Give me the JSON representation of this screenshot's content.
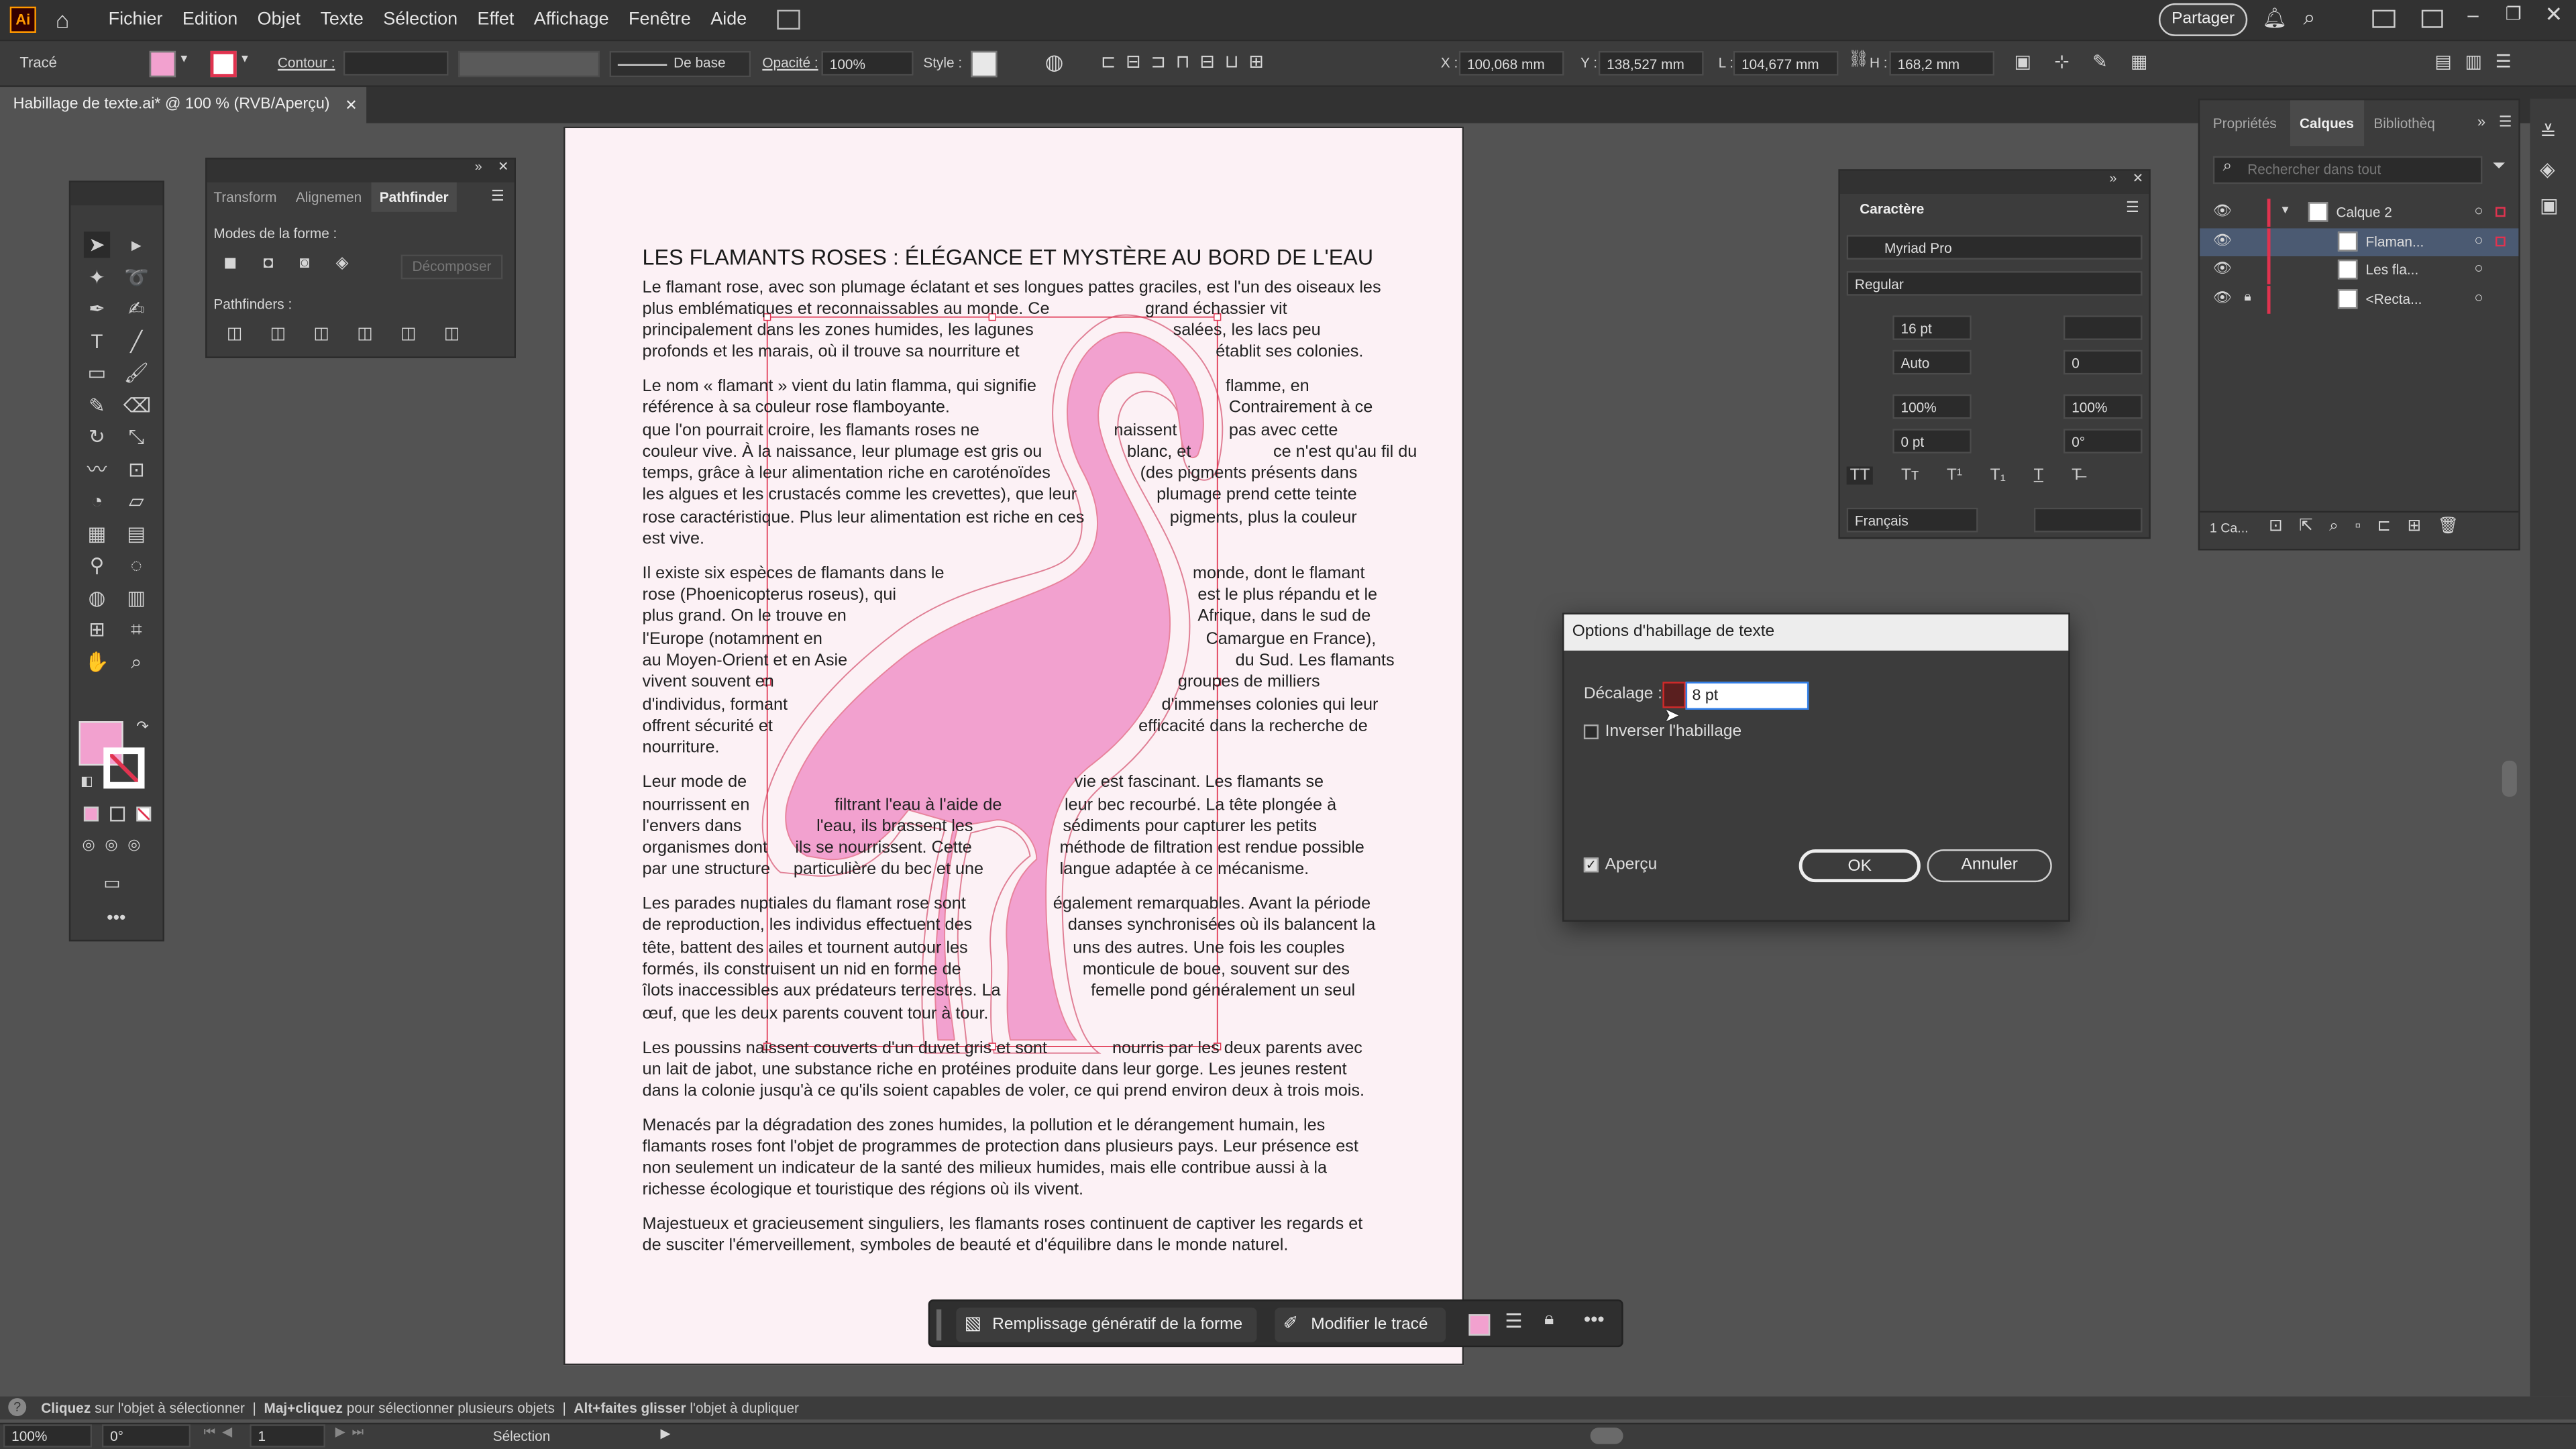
{
  "app": {
    "logo": "Ai",
    "share": "Partager"
  },
  "menu": [
    "Fichier",
    "Edition",
    "Objet",
    "Texte",
    "Sélection",
    "Effet",
    "Affichage",
    "Fenêtre",
    "Aide"
  ],
  "control_bar": {
    "object_type": "Tracé",
    "stroke_label": "Contour :",
    "stroke_style": "De base",
    "opacity_label": "Opacité :",
    "opacity_value": "100%",
    "style_label": "Style :",
    "x_label": "X :",
    "x_value": "100,068 mm",
    "y_label": "Y :",
    "y_value": "138,527 mm",
    "w_label": "L :",
    "w_value": "104,677 mm",
    "h_label": "H :",
    "h_value": "168,2 mm",
    "fill_color": "#f2a1cf"
  },
  "document_tab": {
    "title": "Habillage de texte.ai* @ 100 % (RVB/Aperçu)"
  },
  "pathfinder_panel": {
    "tabs": [
      "Transform",
      "Alignemen",
      "Pathfinder"
    ],
    "shape_modes_label": "Modes de la forme :",
    "expand_label": "Décomposer",
    "pathfinders_label": "Pathfinders :"
  },
  "character_panel": {
    "title": "Caractère",
    "font": "Myriad Pro",
    "style": "Regular",
    "size": "16 pt",
    "leading": "",
    "kerning": "Auto",
    "tracking": "0",
    "vscale": "100%",
    "hscale": "100%",
    "baseline": "0 pt",
    "rotation": "0°",
    "language": "Français"
  },
  "right_panel": {
    "tabs": [
      "Propriétés",
      "Calques",
      "Bibliothèq"
    ],
    "search_placeholder": "Rechercher dans tout",
    "layers": [
      {
        "name": "Calque 2"
      },
      {
        "name": "Flaman..."
      },
      {
        "name": "Les fla..."
      },
      {
        "name": "<Recta..."
      }
    ],
    "footer_label": "1 Ca..."
  },
  "dialog": {
    "title": "Options d'habillage de texte",
    "offset_label": "Décalage :",
    "offset_value": "8 pt",
    "invert_label": "Inverser l'habillage",
    "preview_label": "Aperçu",
    "ok_label": "OK",
    "cancel_label": "Annuler"
  },
  "context_bar": {
    "gen_fill": "Remplissage génératif de la forme",
    "edit_path": "Modifier le tracé"
  },
  "status_bar": {
    "hint_a_bold": "Cliquez",
    "hint_a": "sur l'objet à sélectionner",
    "hint_b_bold": "Maj+cliquez",
    "hint_b": "pour sélectionner plusieurs objets",
    "hint_c_bold": "Alt+faites glisser",
    "hint_c": "l'objet à dupliquer"
  },
  "bottom_bar": {
    "zoom": "100%",
    "rotation": "0°",
    "artboard": "1",
    "tool": "Sélection"
  },
  "document": {
    "title": "LES FLAMANTS ROSES : ÉLÉGANCE ET MYSTÈRE AU BORD DE L'EAU",
    "lines": [
      [
        "Le flamant rose, avec son plumage éclatant et ses longues pattes graciles, est l'un des oiseaux les"
      ],
      [
        "plus emblématiques et reconnaissables au monde. Ce",
        "grand échassier vit"
      ],
      [
        "principalement dans les zones humides, les lagunes",
        "salées, les lacs peu"
      ],
      [
        "profonds et les marais, où il trouve sa nourriture et",
        "établit ses colonies."
      ],
      [
        "Le nom « flamant » vient du latin flamma, qui signifie",
        "flamme, en"
      ],
      [
        "référence à sa couleur rose flamboyante.",
        "Contrairement à ce"
      ],
      [
        "que l'on pourrait croire, les flamants roses ne",
        "naissent",
        "pas avec cette"
      ],
      [
        "couleur vive. À la naissance, leur plumage est gris ou",
        "blanc, et",
        "ce n'est qu'au fil du"
      ],
      [
        "temps, grâce à leur alimentation riche en caroténoïdes",
        "(des pigments présents dans"
      ],
      [
        "les algues et les crustacés comme les crevettes), que leur",
        "plumage prend cette teinte"
      ],
      [
        "rose caractéristique. Plus leur alimentation est riche en ces",
        "pigments, plus la couleur"
      ],
      [
        "est vive."
      ],
      [
        "Il existe six espèces de flamants dans le",
        "monde, dont le flamant"
      ],
      [
        "rose (Phoenicopterus roseus), qui",
        "est le plus répandu et le"
      ],
      [
        "plus grand. On le trouve en",
        "Afrique, dans le sud de"
      ],
      [
        "l'Europe (notamment en",
        "Camargue en France),"
      ],
      [
        "au Moyen-Orient et en Asie",
        "du Sud. Les flamants"
      ],
      [
        "vivent souvent en",
        "groupes de milliers"
      ],
      [
        "d'individus, formant",
        "d'immenses colonies qui leur"
      ],
      [
        "offrent sécurité et",
        "efficacité dans la recherche de"
      ],
      [
        "nourriture."
      ],
      [
        "Leur mode de",
        "vie est fascinant. Les flamants se"
      ],
      [
        "nourrissent en",
        "filtrant l'eau à l'aide de",
        "leur bec recourbé. La tête plongée à"
      ],
      [
        "l'envers dans",
        "l'eau, ils brassent les",
        "sédiments pour capturer les petits"
      ],
      [
        "organismes dont",
        "ils se nourrissent. Cette",
        "méthode de filtration est rendue possible"
      ],
      [
        "par une structure",
        "particulière du bec et une",
        "langue adaptée à ce mécanisme."
      ],
      [
        "Les parades nuptiales du flamant rose sont",
        "également remarquables. Avant la période"
      ],
      [
        "de reproduction, les individus effectuent des",
        "danses synchronisées où ils balancent la"
      ],
      [
        "tête, battent des ailes et tournent autour les",
        "uns des autres. Une fois les couples"
      ],
      [
        "formés, ils construisent un nid en forme de",
        "monticule de boue, souvent sur des"
      ],
      [
        "îlots inaccessibles aux prédateurs terrestres. La",
        "femelle pond généralement un seul"
      ],
      [
        "œuf, que les deux parents couvent tour à tour."
      ],
      [
        "Les poussins naissent couverts d'un duvet gris et sont",
        "nourris par les deux parents avec"
      ],
      [
        "un lait de jabot, une substance riche en protéines produite dans leur gorge. Les jeunes restent"
      ],
      [
        "dans la colonie jusqu'à ce qu'ils soient capables de voler, ce qui prend environ deux à trois mois."
      ],
      [
        "Menacés par la dégradation des zones humides, la pollution et le dérangement humain, les"
      ],
      [
        "flamants roses font l'objet de programmes de protection dans plusieurs pays. Leur présence est"
      ],
      [
        "non seulement un indicateur de la santé des milieux humides, mais elle contribue aussi à la"
      ],
      [
        "richesse écologique et touristique des régions où ils vivent."
      ],
      [
        "Majestueux et gracieusement singuliers, les flamants roses continuent de captiver les regards et"
      ],
      [
        "de susciter l'émerveillement, symboles de beauté et d'équilibre dans le monde naturel."
      ]
    ]
  },
  "colors": {
    "flamingo": "#f2a1cf",
    "selection": "#e0334f",
    "ui_dark": "#323232",
    "ui_panel": "#3c3c3c"
  }
}
